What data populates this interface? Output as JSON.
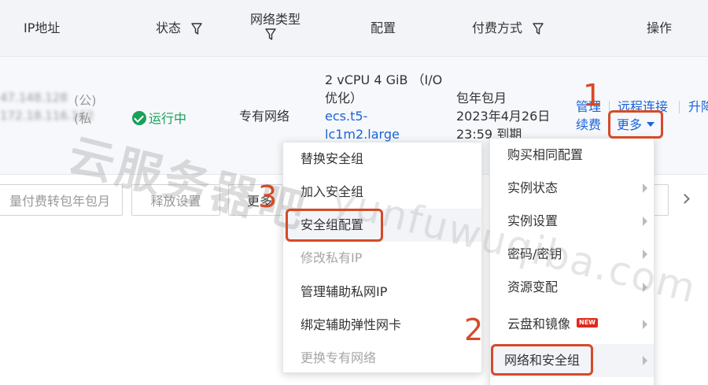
{
  "table": {
    "headers": {
      "ip": "IP地址",
      "status": "状态",
      "network_type": "网络类型",
      "config": "配置",
      "billing": "付费方式",
      "actions": "操作"
    },
    "row": {
      "ip_public": "47.148.128",
      "ip_public_note": "(公)",
      "ip_private": "172.18.116.162",
      "ip_private_note": "(私",
      "status": "运行中",
      "network_type": "专有网络",
      "config_line1": "2 vCPU 4 GiB （I/O",
      "config_line2": "优化）",
      "instance_type_line1": "ecs.t5-",
      "instance_type_line2": "lc1m2.large",
      "billing_line1": "包年包月",
      "billing_line2": "2023年4月26日",
      "billing_line3": "23:59 到期",
      "action_manage": "管理",
      "action_remote": "远程连接",
      "action_upgrade": "升降",
      "action_renew": "续费",
      "action_more": "更多"
    }
  },
  "toolbar": {
    "convert_billing": "量付费转包年包月",
    "release_settings": "释放设置",
    "more": "更多"
  },
  "more_menu": [
    {
      "label": "购买相同配置",
      "submenu": false
    },
    {
      "label": "实例状态",
      "submenu": true
    },
    {
      "label": "实例设置",
      "submenu": true
    },
    {
      "label": "密码/密钥",
      "submenu": true
    },
    {
      "label": "资源变配",
      "submenu": true
    },
    {
      "label": "云盘和镜像",
      "submenu": true,
      "badge": "NEW"
    },
    {
      "label": "网络和安全组",
      "submenu": true
    }
  ],
  "network_submenu": [
    {
      "label": "替换安全组",
      "disabled": false
    },
    {
      "label": "加入安全组",
      "disabled": false
    },
    {
      "label": "安全组配置",
      "disabled": false
    },
    {
      "label": "修改私有IP",
      "disabled": true
    },
    {
      "label": "管理辅助私网IP",
      "disabled": false
    },
    {
      "label": "绑定辅助弹性网卡",
      "disabled": false
    },
    {
      "label": "更换专有网络",
      "disabled": true
    }
  ],
  "annotations": {
    "step1": "1",
    "step2": "2",
    "step3": "3",
    "color": "#d64a27"
  },
  "watermark": {
    "cn": "云服务器吧",
    "en": "yunfuwuqiba.com"
  },
  "colors": {
    "link": "#1a63d9",
    "running": "#1aa05a",
    "header_bg": "#f2f4f8"
  }
}
